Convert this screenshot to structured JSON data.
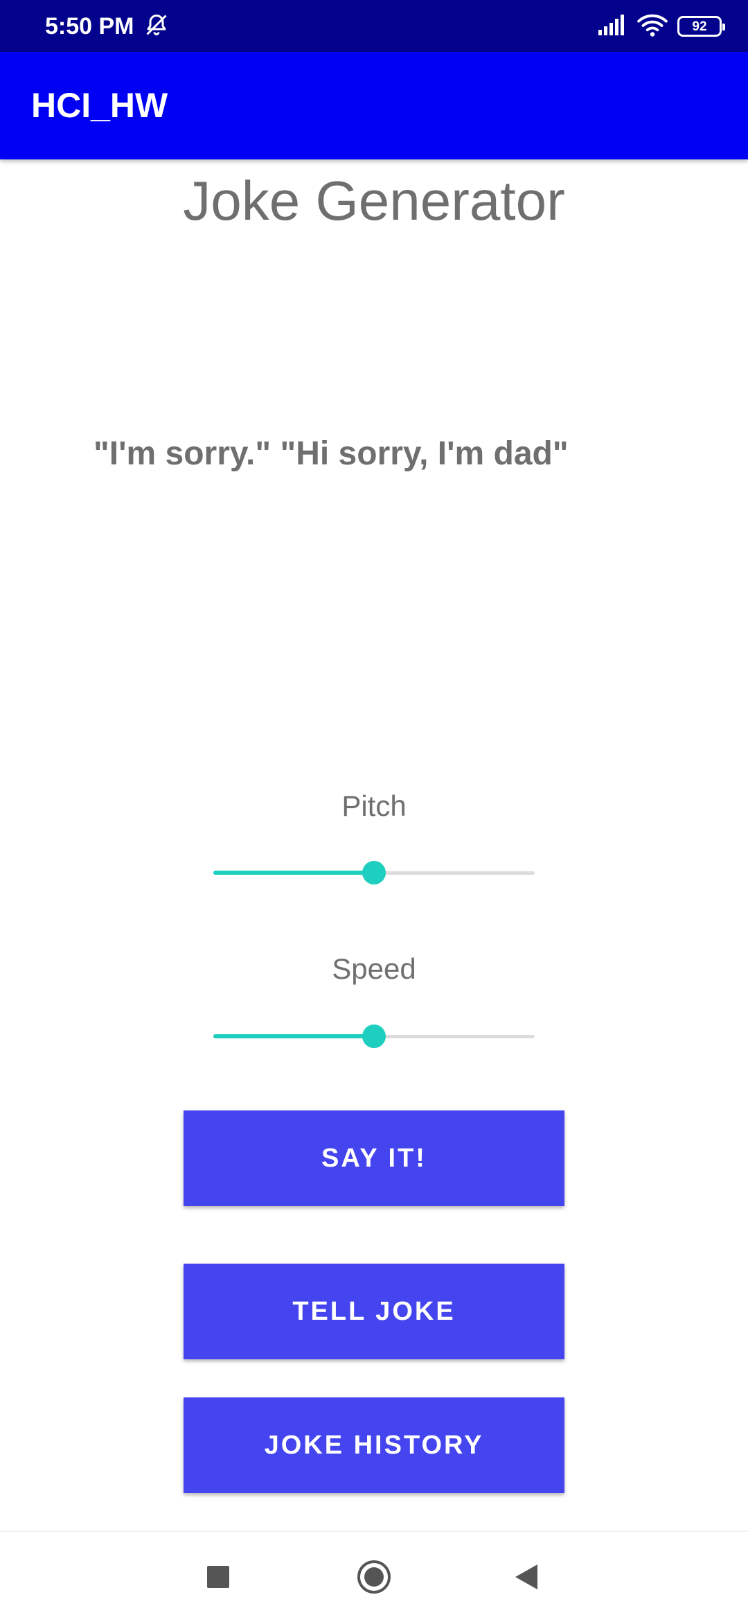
{
  "status_bar": {
    "time": "5:50 PM",
    "battery": "92",
    "icons": [
      "alarm-off-icon",
      "signal-icon",
      "wifi-icon",
      "battery-icon"
    ]
  },
  "app_bar": {
    "title": "HCI_HW",
    "color": "#0000f2"
  },
  "main": {
    "title": "Joke Generator",
    "joke": "\"I'm sorry.\" \"Hi sorry, I'm dad\"",
    "pitch": {
      "label": "Pitch",
      "value": 0.5
    },
    "speed": {
      "label": "Speed",
      "value": 0.5
    },
    "buttons": {
      "say_it": "SAY IT!",
      "tell_joke": "TELL JOKE",
      "joke_history": "JOKE HISTORY"
    },
    "accent_color": "#1ecfbf",
    "button_color": "#4545ef"
  },
  "nav_bar": {
    "icons": [
      "recents-icon",
      "home-icon",
      "back-icon"
    ]
  }
}
